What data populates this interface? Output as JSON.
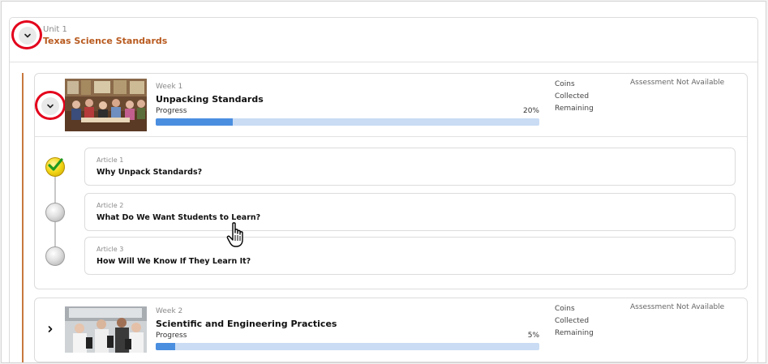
{
  "unit": {
    "number_label": "Unit 1",
    "title": "Texas Science Standards",
    "toggle_icon": "chevron-down-icon",
    "title_color": "#b85a1f",
    "highlight_color": "#e3001b"
  },
  "weeks": [
    {
      "number_label": "Week 1",
      "title": "Unpacking Standards",
      "progress_label": "Progress",
      "progress_percent_text": "20%",
      "progress_fraction": 0.2,
      "stats": {
        "coins": "Coins",
        "collected": "Collected",
        "remaining": "Remaining"
      },
      "assessment": "Assessment Not Available",
      "expanded": true,
      "thumbnail": "classroom-teachers-photo",
      "articles": [
        {
          "number_label": "Article 1",
          "title": "Why Unpack Standards?",
          "status": "completed"
        },
        {
          "number_label": "Article 2",
          "title": "What Do We Want Students to Learn?",
          "status": "not-started"
        },
        {
          "number_label": "Article 3",
          "title": "How Will We Know If They Learn It?",
          "status": "not-started"
        }
      ]
    },
    {
      "number_label": "Week 2",
      "title": "Scientific and Engineering Practices",
      "progress_label": "Progress",
      "progress_percent_text": "5%",
      "progress_fraction": 0.05,
      "stats": {
        "coins": "Coins",
        "collected": "Collected",
        "remaining": "Remaining"
      },
      "assessment": "Assessment Not Available",
      "expanded": false,
      "thumbnail": "students-microscopes-photo"
    }
  ],
  "colors": {
    "progress_fill": "#4a8ee0",
    "progress_track": "#c9dcf4",
    "timeline": "#c8793d"
  }
}
